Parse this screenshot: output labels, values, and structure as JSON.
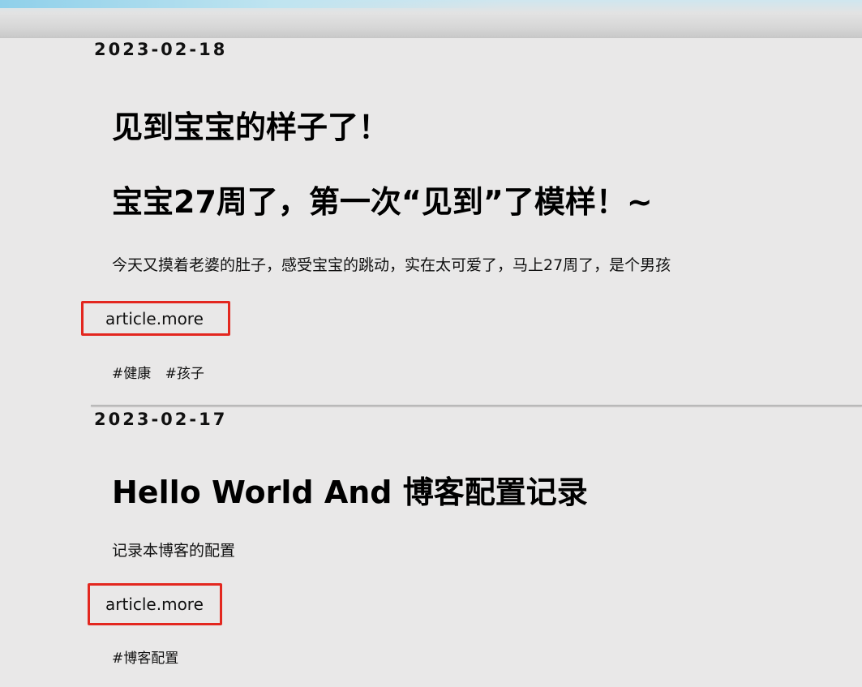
{
  "posts": [
    {
      "date": "2023-02-18",
      "title": "见到宝宝的样子了！",
      "subtitle": "宝宝27周了，第一次“见到”了模样！~",
      "summary": "今天又摸着老婆的肚子，感受宝宝的跳动，实在太可爱了，马上27周了，是个男孩",
      "more_label": "article.more",
      "tags": [
        "#健康",
        "#孩子"
      ]
    },
    {
      "date": "2023-02-17",
      "title": "Hello World And 博客配置记录",
      "summary": "记录本博客的配置",
      "more_label": "article.more",
      "tags": [
        "#博客配置"
      ]
    }
  ],
  "colors": {
    "background": "#e9e8e8",
    "highlight": "#e3271f"
  }
}
